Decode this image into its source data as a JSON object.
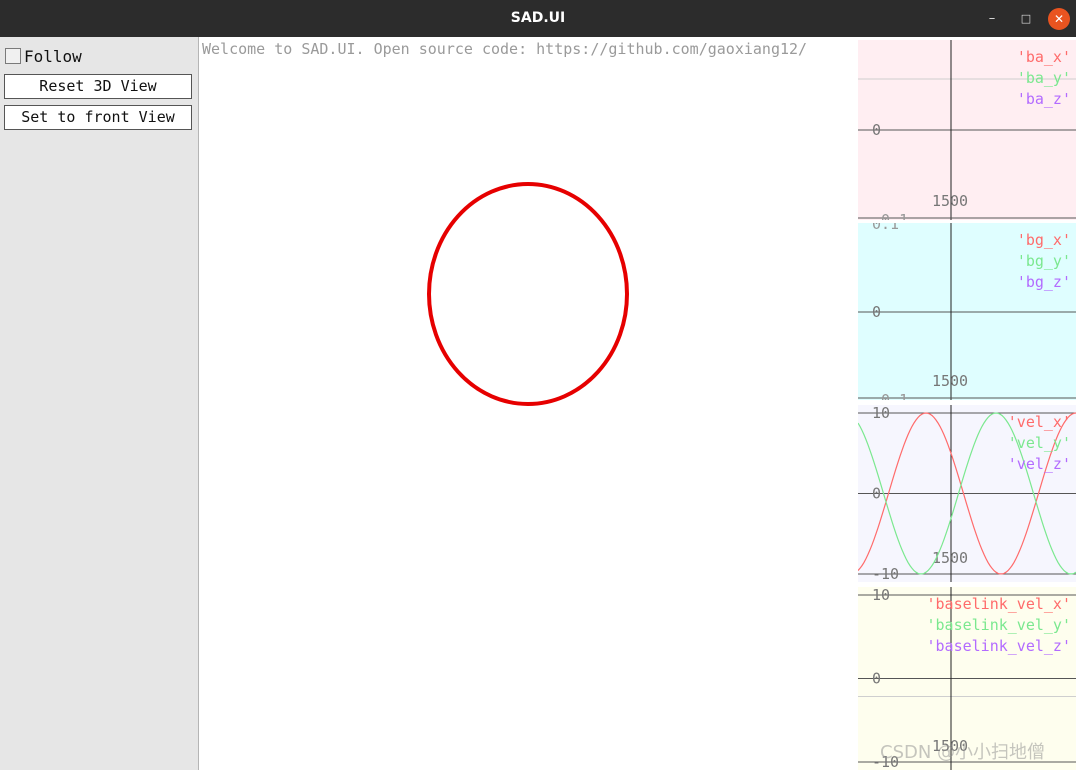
{
  "window": {
    "title": "SAD.UI",
    "minimize_icon": "–",
    "maximize_icon": "□",
    "close_icon": "✕"
  },
  "panel": {
    "follow_label": "Follow",
    "follow_checked": false,
    "reset_button": "Reset 3D View",
    "front_button": "Set to front View"
  },
  "viewport": {
    "welcome_text": "Welcome to SAD.UI. Open source code: https://github.com/gaoxiang12/",
    "trajectory_color": "#e60000"
  },
  "plots": [
    {
      "id": "ba",
      "background": "#ffeef2",
      "y_tick_labels": [
        "0"
      ],
      "x_tick_label": "1500",
      "clipped_bottom_label": "-0.1",
      "series": [
        {
          "name": "'ba_x'",
          "color": "#ff6b6b"
        },
        {
          "name": "'ba_y'",
          "color": "#7be88f"
        },
        {
          "name": "'ba_z'",
          "color": "#b36bff"
        }
      ]
    },
    {
      "id": "bg",
      "background": "#dffeff",
      "y_tick_labels": [
        "0"
      ],
      "x_tick_label": "1500",
      "clipped_top_label": "0.1",
      "clipped_bottom_label": "-0.1",
      "series": [
        {
          "name": "'bg_x'",
          "color": "#ff6b6b"
        },
        {
          "name": "'bg_y'",
          "color": "#7be88f"
        },
        {
          "name": "'bg_z'",
          "color": "#b36bff"
        }
      ]
    },
    {
      "id": "vel",
      "background": "#f6f6fe",
      "y_tick_labels": [
        "10",
        "0",
        "-10"
      ],
      "x_tick_label": "1500",
      "series": [
        {
          "name": "'vel_x'",
          "color": "#ff6b6b"
        },
        {
          "name": "'vel_y'",
          "color": "#7be88f"
        },
        {
          "name": "'vel_z'",
          "color": "#b36bff"
        }
      ]
    },
    {
      "id": "baselink",
      "background": "#fefeee",
      "y_tick_labels": [
        "10",
        "0",
        "-10"
      ],
      "x_tick_label": "1500",
      "series": [
        {
          "name": "'baselink_vel_x'",
          "color": "#ff6b6b"
        },
        {
          "name": "'baselink_vel_y'",
          "color": "#7be88f"
        },
        {
          "name": "'baselink_vel_z'",
          "color": "#b36bff"
        }
      ]
    }
  ],
  "watermark": "CSDN @小小扫地僧"
}
